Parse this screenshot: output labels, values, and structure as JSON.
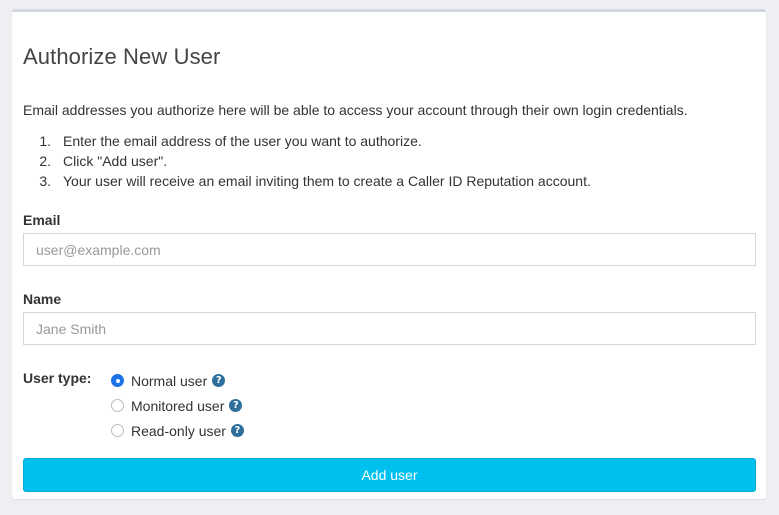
{
  "form": {
    "title": "Authorize New User",
    "intro": "Email addresses you authorize here will be able to access your account through their own login credentials.",
    "steps": [
      {
        "num": "1.",
        "text": "Enter the email address of the user you want to authorize."
      },
      {
        "num": "2.",
        "text": "Click \"Add user\"."
      },
      {
        "num": "3.",
        "text": "Your user will receive an email inviting them to create a Caller ID Reputation account."
      }
    ],
    "email": {
      "label": "Email",
      "placeholder": "user@example.com",
      "value": ""
    },
    "name": {
      "label": "Name",
      "placeholder": "Jane Smith",
      "value": ""
    },
    "user_type": {
      "label": "User type:",
      "selected": "Normal user",
      "options": [
        {
          "label": "Normal user",
          "help_icon": "question-circle-icon"
        },
        {
          "label": "Monitored user",
          "help_icon": "question-circle-icon"
        },
        {
          "label": "Read-only user",
          "help_icon": "question-circle-icon"
        }
      ]
    },
    "submit_label": "Add user"
  },
  "colors": {
    "accent_button": "#00c0ef",
    "radio_checked": "#1a73e8",
    "help_icon": "#2f6f9c",
    "page_background": "#eeeff3"
  }
}
